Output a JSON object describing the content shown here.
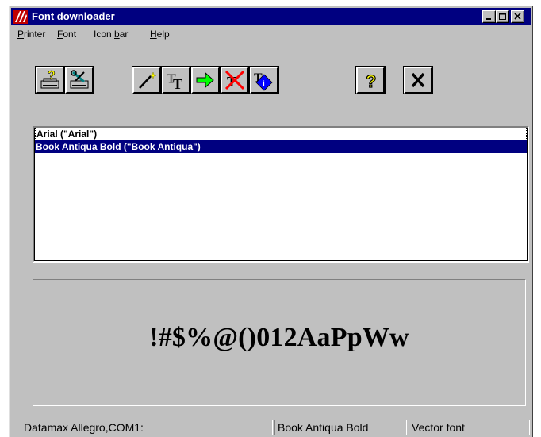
{
  "window": {
    "title": "Font downloader"
  },
  "menu": {
    "items": [
      {
        "accel": "P",
        "rest": "rinter"
      },
      {
        "accel": "F",
        "rest": "ont"
      },
      {
        "pre": "Icon ",
        "accel": "b",
        "rest": "ar"
      },
      {
        "accel": "H",
        "rest": "elp"
      }
    ]
  },
  "toolbar": {
    "buttons": [
      {
        "name": "printer-setup-icon"
      },
      {
        "name": "printer-tools-icon"
      },
      {
        "name": "magic-wand-icon"
      },
      {
        "name": "truetype-font-icon"
      },
      {
        "name": "download-arrow-icon"
      },
      {
        "name": "delete-font-icon"
      },
      {
        "name": "font-info-icon"
      },
      {
        "name": "help-icon",
        "label": "?"
      },
      {
        "name": "close-icon",
        "label": "✕"
      }
    ]
  },
  "font_list": {
    "items": [
      {
        "label": "Arial (\"Arial\")",
        "selected": false,
        "focused": true
      },
      {
        "label": "Book Antiqua Bold (\"Book Antiqua\")",
        "selected": true,
        "focused": false
      }
    ]
  },
  "preview": {
    "sample_text": "!#$%@()012AaPpWw"
  },
  "status": {
    "printer": "Datamax Allegro,COM1:",
    "font_name": "Book Antiqua Bold",
    "font_type": "Vector font"
  },
  "colors": {
    "face": "#c0c0c0",
    "title_bar": "#000080",
    "selection": "#000080"
  }
}
